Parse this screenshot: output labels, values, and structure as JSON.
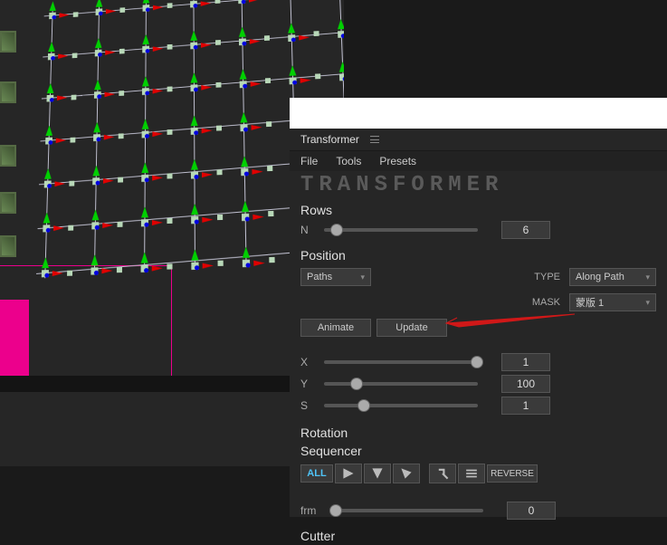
{
  "panel": {
    "title": "Transformer",
    "menu": {
      "file": "File",
      "tools": "Tools",
      "presets": "Presets"
    },
    "logo": "TRANSFORMER",
    "rows": {
      "label": "Rows",
      "n_label": "N",
      "n_value": "6"
    },
    "position": {
      "label": "Position",
      "paths_label": "Paths",
      "type_label": "TYPE",
      "type_value": "Along Path",
      "mask_label": "MASK",
      "mask_value": "蒙版 1",
      "animate": "Animate",
      "update": "Update",
      "x_label": "X",
      "x_value": "1",
      "y_label": "Y",
      "y_value": "100",
      "s_label": "S",
      "s_value": "1"
    },
    "rotation": {
      "label1": "Rotation",
      "label2": "Sequencer",
      "all": "ALL",
      "reverse": "REVERSE",
      "frm_label": "frm",
      "frm_value": "0"
    },
    "cutter": {
      "label": "Cutter"
    }
  },
  "chart_data": {
    "type": "table",
    "title": "Transformer panel control values",
    "rows": [
      {
        "control": "Rows N",
        "value": 6,
        "range": [
          0,
          100
        ],
        "slider_percent": 4
      },
      {
        "control": "Position X",
        "value": 1,
        "range": [
          0,
          1
        ],
        "slider_percent": 95
      },
      {
        "control": "Position Y",
        "value": 100,
        "range": [
          0,
          500
        ],
        "slider_percent": 17
      },
      {
        "control": "Position S",
        "value": 1,
        "range": [
          0,
          5
        ],
        "slider_percent": 22
      },
      {
        "control": "Sequencer frm",
        "value": 0,
        "range": [
          0,
          100
        ],
        "slider_percent": 0
      }
    ]
  }
}
